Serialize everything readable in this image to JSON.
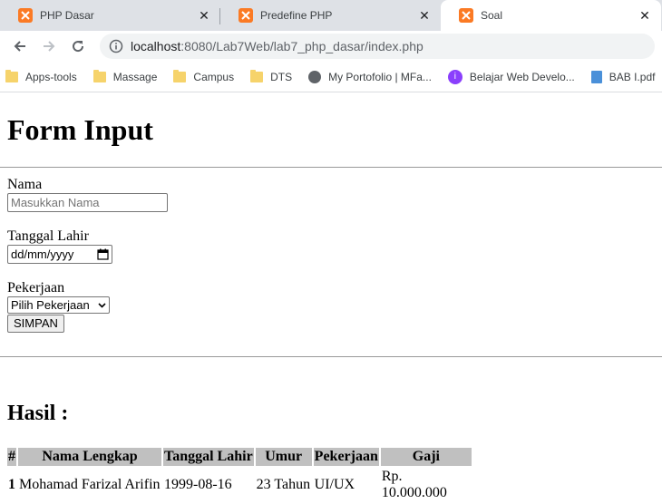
{
  "tabs": [
    {
      "label": "PHP Dasar",
      "active": false
    },
    {
      "label": "Predefine PHP",
      "active": false
    },
    {
      "label": "Soal",
      "active": true
    }
  ],
  "address": {
    "host": "localhost",
    "path": ":8080/Lab7Web/lab7_php_dasar/index.php"
  },
  "bookmarks": [
    {
      "label": "Apps-tools",
      "icon": "folder-icon"
    },
    {
      "label": "Massage",
      "icon": "folder-icon"
    },
    {
      "label": "Campus",
      "icon": "folder-icon"
    },
    {
      "label": "DTS",
      "icon": "folder-icon"
    },
    {
      "label": "My Portofolio | MFa...",
      "icon": "globe-icon"
    },
    {
      "label": "Belajar Web Develo...",
      "icon": "site-icon"
    },
    {
      "label": "BAB I.pdf",
      "icon": "document-icon"
    }
  ],
  "form": {
    "title": "Form Input",
    "nama_label": "Nama",
    "nama_placeholder": "Masukkan Nama",
    "tanggal_label": "Tanggal Lahir",
    "tanggal_placeholder": "dd/mm/yyyy",
    "pekerjaan_label": "Pekerjaan",
    "pekerjaan_selected": "Pilih Pekerjaan",
    "submit_label": "SIMPAN"
  },
  "hasil": {
    "title": "Hasil :",
    "headers": [
      "#",
      "Nama Lengkap",
      "Tanggal Lahir",
      "Umur",
      "Pekerjaan",
      "Gaji"
    ],
    "rows": [
      [
        "1",
        "Mohamad Farizal Arifin",
        "1999-08-16",
        "23 Tahun",
        "UI/UX",
        "Rp. 10.000.000"
      ]
    ]
  },
  "colors": {
    "tab_favicon": "#fb7a24",
    "tabstrip": "#dee1e6",
    "table_header": "#c0c0c0"
  }
}
